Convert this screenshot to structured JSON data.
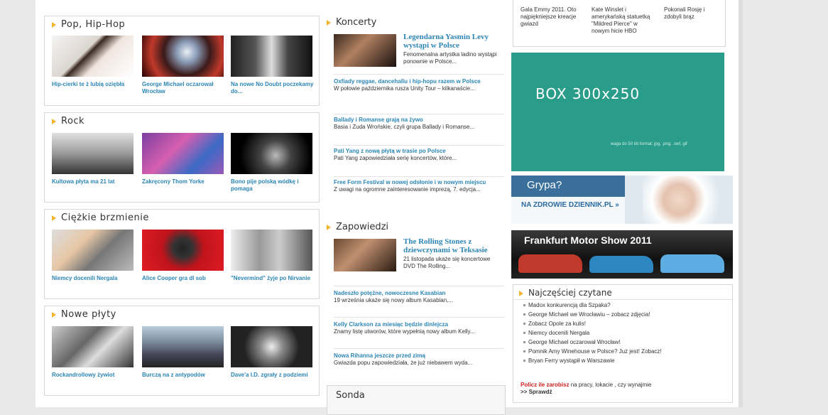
{
  "sections": {
    "pop": {
      "title": "Pop, Hip-Hop",
      "items": [
        {
          "caption": "Hip-cierki te ż lubią oziębła"
        },
        {
          "caption": "George Michael oczarował Wrocław"
        },
        {
          "caption": "Na nowe No Doubt poczekamy do..."
        }
      ]
    },
    "rock": {
      "title": "Rock",
      "items": [
        {
          "caption": "Kultowa płyta ma 21 lat"
        },
        {
          "caption": "Zakręcony Thom Yorke"
        },
        {
          "caption": "Bono pije polską wódkę i pomaga"
        }
      ]
    },
    "heavy": {
      "title": "Ciężkie brzmienie",
      "items": [
        {
          "caption": "Niemcy docenili Nergala"
        },
        {
          "caption": "Alice Cooper gra dl sob"
        },
        {
          "caption": "\"Nevermind\" żyje po Nirvanie"
        }
      ]
    },
    "newalbums": {
      "title": "Nowe płyty",
      "items": [
        {
          "caption": "Rockandrollowy żywiot"
        },
        {
          "caption": "Burczą na z antypodów"
        },
        {
          "caption": "Dave'a I.D. zgrały z podziemi"
        }
      ]
    }
  },
  "concerts": {
    "title": "Koncerty",
    "featured": {
      "title": "Legendarna Yasmin Levy wystąpi w Polsce",
      "text": "Fenomenalna artystka ladino wystąpi ponownie w Polsce..."
    },
    "items": [
      {
        "title": "Oxfiady reggae, dancehallu i hip-hopu razem w Polsce",
        "text": "W połowie października rusza Unity Tour – kilkanaście..."
      },
      {
        "title": "Ballady i Romanse grają na żywo",
        "text": "Basia i Zuda Wrońskie, czyli grupa Ballady i Romanse..."
      },
      {
        "title": "Pati Yang z nową płytą w trasie po Polsce",
        "text": "Pati Yang zapowiedziała serię koncertów, które..."
      },
      {
        "title": "Free Form Festival w nowej odsłonie i w nowym miejscu",
        "text": "Z uwagi na ogromne zainteresowanie imprezą, 7. edycja..."
      }
    ]
  },
  "announcements": {
    "title": "Zapowiedzi",
    "featured": {
      "title": "The Rolling Stones z dziewczynami w Teksasie",
      "text": "21 listopada ukaże się koncertowe DVD The Rolling..."
    },
    "items": [
      {
        "title": "Nadeszło potężne, nowoczesne Kasabian",
        "text": "19 września ukaże się nowy album Kasabian,..."
      },
      {
        "title": "Kelly Clarkson za miesiąc będzie dinlejcza",
        "text": "Znamy listę utworów, które wypełnią nowy album Kelly..."
      },
      {
        "title": "Nowa Rihanna jeszcze przed zimą",
        "text": "Gwiazda popu zapowiedziała, że już niebawem wyda..."
      }
    ]
  },
  "poll": {
    "title": "Sonda"
  },
  "topnews": [
    {
      "text": "Gala Emmy 2011. Oto najpiękniejsze kreacje gwiazd"
    },
    {
      "text": "Kate Winslet i amerykańską statuetką \"Mildred Pierce\" w nowym hicie HBO"
    },
    {
      "text": "Pokonali Rosję i zdobyli brąz"
    }
  ],
  "ad_box": {
    "title": "BOX 300x250",
    "sub": "waga do 50 kb format: jpg, .png, .swf, gif"
  },
  "flu_banner": {
    "title": "Grypa?",
    "link": "NA ZDROWIE DZIENNIK.PL »"
  },
  "motor_banner": {
    "title": "Frankfurt Motor Show 2011"
  },
  "most_read": {
    "title": "Najczęściej czytane",
    "items": [
      {
        "text": "Madox konkurencją dla Szpaka?"
      },
      {
        "text": "George Michael we Wrocławiu – zobacz zdjęcia!"
      },
      {
        "text": "Zobacz Opole za kulis!"
      },
      {
        "text": "Niemcy docenili Nergala"
      },
      {
        "text": "George Michael oczarował Wrocław!"
      },
      {
        "text": "Pomnik Amy Winehouse w Polsce? Już jest! Zobacz!"
      },
      {
        "text": "Bryan Ferry wystąpił w Warszawie"
      }
    ],
    "promo_red": "Policz ile zarobisz",
    "promo_text": " na pracy, lokacie , czy wynajmie",
    "promo_link": ">> Sprawdź"
  },
  "colors": {
    "accent_blue": "#2b86b5",
    "bullet_orange": "#f2b533",
    "ad_teal": "#2a9c8a"
  }
}
